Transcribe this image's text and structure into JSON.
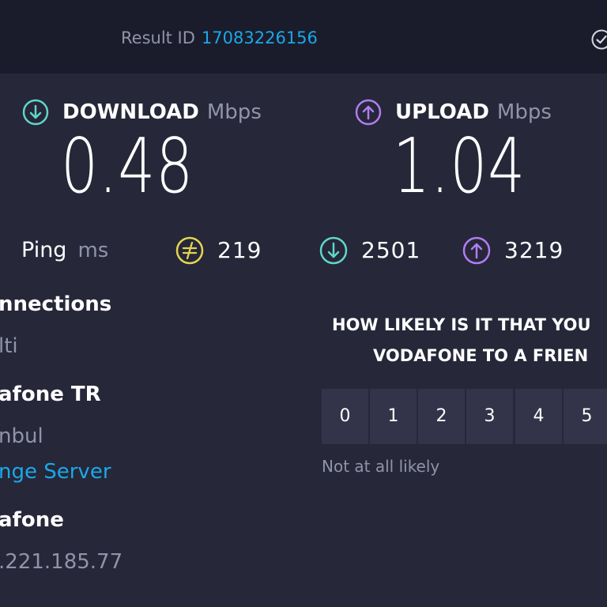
{
  "header": {
    "result_label": "Result ID",
    "result_id": "17083226156",
    "check_icon": "check-circle-icon"
  },
  "download": {
    "label": "DOWNLOAD",
    "unit": "Mbps",
    "value": "0.48",
    "icon": "download-arrow-icon",
    "icon_color": "#5fd6c8"
  },
  "upload": {
    "label": "UPLOAD",
    "unit": "Mbps",
    "value": "1.04",
    "icon": "upload-arrow-icon",
    "icon_color": "#b07df2"
  },
  "ping": {
    "label": "Ping",
    "unit": "ms",
    "idle": {
      "value": "219",
      "icon": "latency-idle-icon",
      "color": "#e3d453"
    },
    "download": {
      "value": "2501",
      "icon": "latency-download-icon",
      "color": "#5fd6c8"
    },
    "upload": {
      "value": "3219",
      "icon": "latency-upload-icon",
      "color": "#b07df2"
    }
  },
  "info": {
    "connections_title": "nnections",
    "connections_value": "lti",
    "server_name": "afone TR",
    "server_city": "nbul",
    "change_server_link": "nge Server",
    "provider_name": "afone",
    "ip_address": ".221.185.77"
  },
  "survey": {
    "question_line1": "HOW LIKELY IS IT THAT YOU",
    "question_line2": "VODAFONE TO A FRIEN",
    "scale": [
      "0",
      "1",
      "2",
      "3",
      "4",
      "5"
    ],
    "low_caption": "Not at all likely"
  }
}
